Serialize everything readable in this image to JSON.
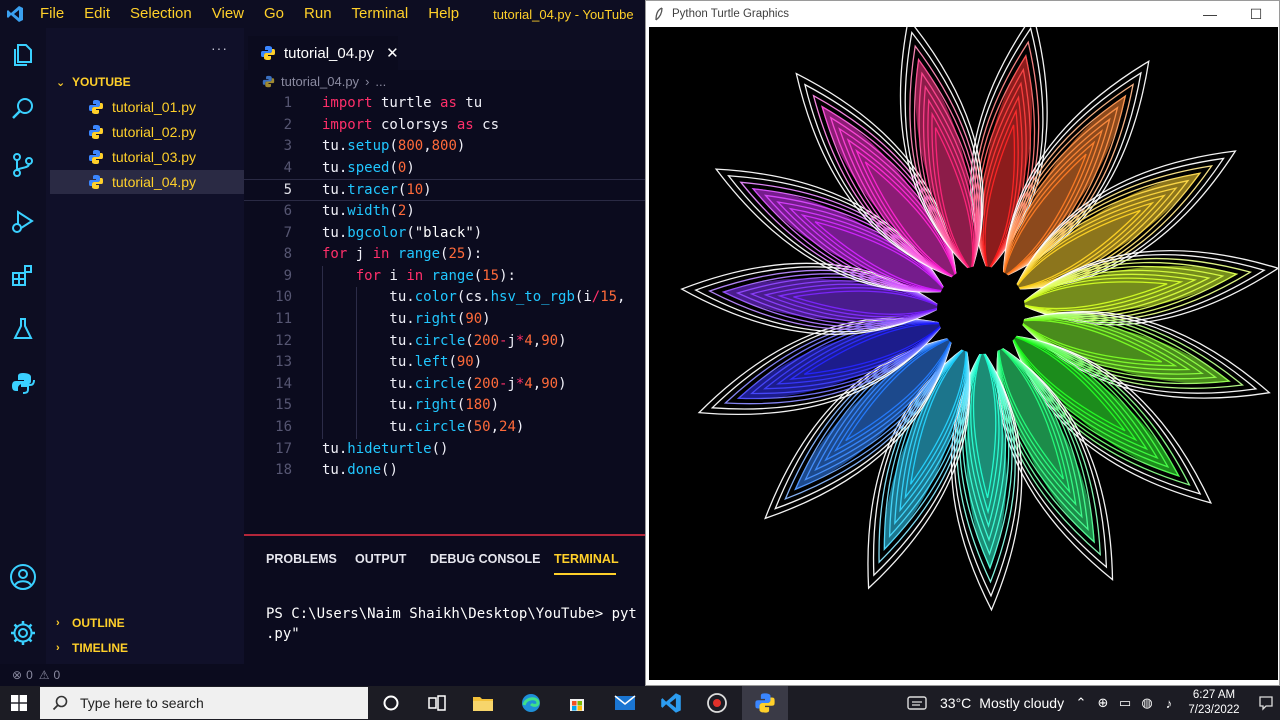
{
  "vscode": {
    "menu": [
      "File",
      "Edit",
      "Selection",
      "View",
      "Go",
      "Run",
      "Terminal",
      "Help"
    ],
    "window_title": "tutorial_04.py - YouTube",
    "sidebar": {
      "folder": "YOUTUBE",
      "files": [
        "tutorial_01.py",
        "tutorial_02.py",
        "tutorial_03.py",
        "tutorial_04.py"
      ],
      "active_file_index": 3,
      "outline": "OUTLINE",
      "timeline": "TIMELINE"
    },
    "tab": {
      "label": "tutorial_04.py",
      "close": "✕"
    },
    "breadcrumb": {
      "file": "tutorial_04.py",
      "tail": "..."
    },
    "code_lines": [
      [
        [
          "kw",
          "import"
        ],
        [
          "id",
          " turtle "
        ],
        [
          "kw",
          "as"
        ],
        [
          "id",
          " tu"
        ]
      ],
      [
        [
          "kw",
          "import"
        ],
        [
          "id",
          " colorsys "
        ],
        [
          "kw",
          "as"
        ],
        [
          "id",
          " cs"
        ]
      ],
      [
        [
          "id",
          "tu."
        ],
        [
          "fn",
          "setup"
        ],
        [
          "id",
          "("
        ],
        [
          "num",
          "800"
        ],
        [
          "id",
          ","
        ],
        [
          "num",
          "800"
        ],
        [
          "id",
          ")"
        ]
      ],
      [
        [
          "id",
          "tu."
        ],
        [
          "fn",
          "speed"
        ],
        [
          "id",
          "("
        ],
        [
          "num",
          "0"
        ],
        [
          "id",
          ")"
        ]
      ],
      [
        [
          "id",
          "tu."
        ],
        [
          "fn",
          "tracer"
        ],
        [
          "id",
          "("
        ],
        [
          "num",
          "10"
        ],
        [
          "id",
          ")"
        ]
      ],
      [
        [
          "id",
          "tu."
        ],
        [
          "fn",
          "width"
        ],
        [
          "id",
          "("
        ],
        [
          "num",
          "2"
        ],
        [
          "id",
          ")"
        ]
      ],
      [
        [
          "id",
          "tu."
        ],
        [
          "fn",
          "bgcolor"
        ],
        [
          "id",
          "("
        ],
        [
          "str",
          "\"black\""
        ],
        [
          "id",
          ")"
        ]
      ],
      [
        [
          "kw",
          "for"
        ],
        [
          "id",
          " j "
        ],
        [
          "kw",
          "in"
        ],
        [
          "id",
          " "
        ],
        [
          "fn",
          "range"
        ],
        [
          "id",
          "("
        ],
        [
          "num",
          "25"
        ],
        [
          "id",
          "):"
        ]
      ],
      [
        [
          "id",
          "    "
        ],
        [
          "kw",
          "for"
        ],
        [
          "id",
          " i "
        ],
        [
          "kw",
          "in"
        ],
        [
          "id",
          " "
        ],
        [
          "fn",
          "range"
        ],
        [
          "id",
          "("
        ],
        [
          "num",
          "15"
        ],
        [
          "id",
          "):"
        ]
      ],
      [
        [
          "id",
          "        tu."
        ],
        [
          "fn",
          "color"
        ],
        [
          "id",
          "(cs."
        ],
        [
          "fn",
          "hsv_to_rgb"
        ],
        [
          "id",
          "(i"
        ],
        [
          "op",
          "/"
        ],
        [
          "num",
          "15"
        ],
        [
          "id",
          ","
        ]
      ],
      [
        [
          "id",
          "        tu."
        ],
        [
          "fn",
          "right"
        ],
        [
          "id",
          "("
        ],
        [
          "num",
          "90"
        ],
        [
          "id",
          ")"
        ]
      ],
      [
        [
          "id",
          "        tu."
        ],
        [
          "fn",
          "circle"
        ],
        [
          "id",
          "("
        ],
        [
          "num",
          "200"
        ],
        [
          "op",
          "-"
        ],
        [
          "id",
          "j"
        ],
        [
          "op",
          "*"
        ],
        [
          "num",
          "4"
        ],
        [
          "id",
          ","
        ],
        [
          "num",
          "90"
        ],
        [
          "id",
          ")"
        ]
      ],
      [
        [
          "id",
          "        tu."
        ],
        [
          "fn",
          "left"
        ],
        [
          "id",
          "("
        ],
        [
          "num",
          "90"
        ],
        [
          "id",
          ")"
        ]
      ],
      [
        [
          "id",
          "        tu."
        ],
        [
          "fn",
          "circle"
        ],
        [
          "id",
          "("
        ],
        [
          "num",
          "200"
        ],
        [
          "op",
          "-"
        ],
        [
          "id",
          "j"
        ],
        [
          "op",
          "*"
        ],
        [
          "num",
          "4"
        ],
        [
          "id",
          ","
        ],
        [
          "num",
          "90"
        ],
        [
          "id",
          ")"
        ]
      ],
      [
        [
          "id",
          "        tu."
        ],
        [
          "fn",
          "right"
        ],
        [
          "id",
          "("
        ],
        [
          "num",
          "180"
        ],
        [
          "id",
          ")"
        ]
      ],
      [
        [
          "id",
          "        tu."
        ],
        [
          "fn",
          "circle"
        ],
        [
          "id",
          "("
        ],
        [
          "num",
          "50"
        ],
        [
          "id",
          ","
        ],
        [
          "num",
          "24"
        ],
        [
          "id",
          ")"
        ]
      ],
      [
        [
          "id",
          "tu."
        ],
        [
          "fn",
          "hideturtle"
        ],
        [
          "id",
          "()"
        ]
      ],
      [
        [
          "id",
          "tu."
        ],
        [
          "fn",
          "done"
        ],
        [
          "id",
          "()"
        ]
      ]
    ],
    "current_line": 5,
    "panel_tabs": [
      "PROBLEMS",
      "OUTPUT",
      "DEBUG CONSOLE",
      "TERMINAL"
    ],
    "active_panel_tab": "TERMINAL",
    "terminal_lines": [
      "PS C:\\Users\\Naim Shaikh\\Desktop\\YouTube> pyt",
      ".py\""
    ],
    "status": {
      "errors": "0",
      "warnings": "0"
    }
  },
  "turtle_window": {
    "title": "Python Turtle Graphics",
    "minimize": "—",
    "maximize": "☐"
  },
  "taskbar": {
    "search_placeholder": "Type here to search",
    "weather_temp": "33°C",
    "weather_text": "Mostly cloudy",
    "time": "6:27 AM",
    "date": "7/23/2022"
  },
  "colors": {
    "menu_text": "#ffd02a",
    "keyword": "#ff2f6a",
    "function": "#21c7ff",
    "number": "#ff6a3a",
    "editor_bg": "#0b0b1e"
  }
}
